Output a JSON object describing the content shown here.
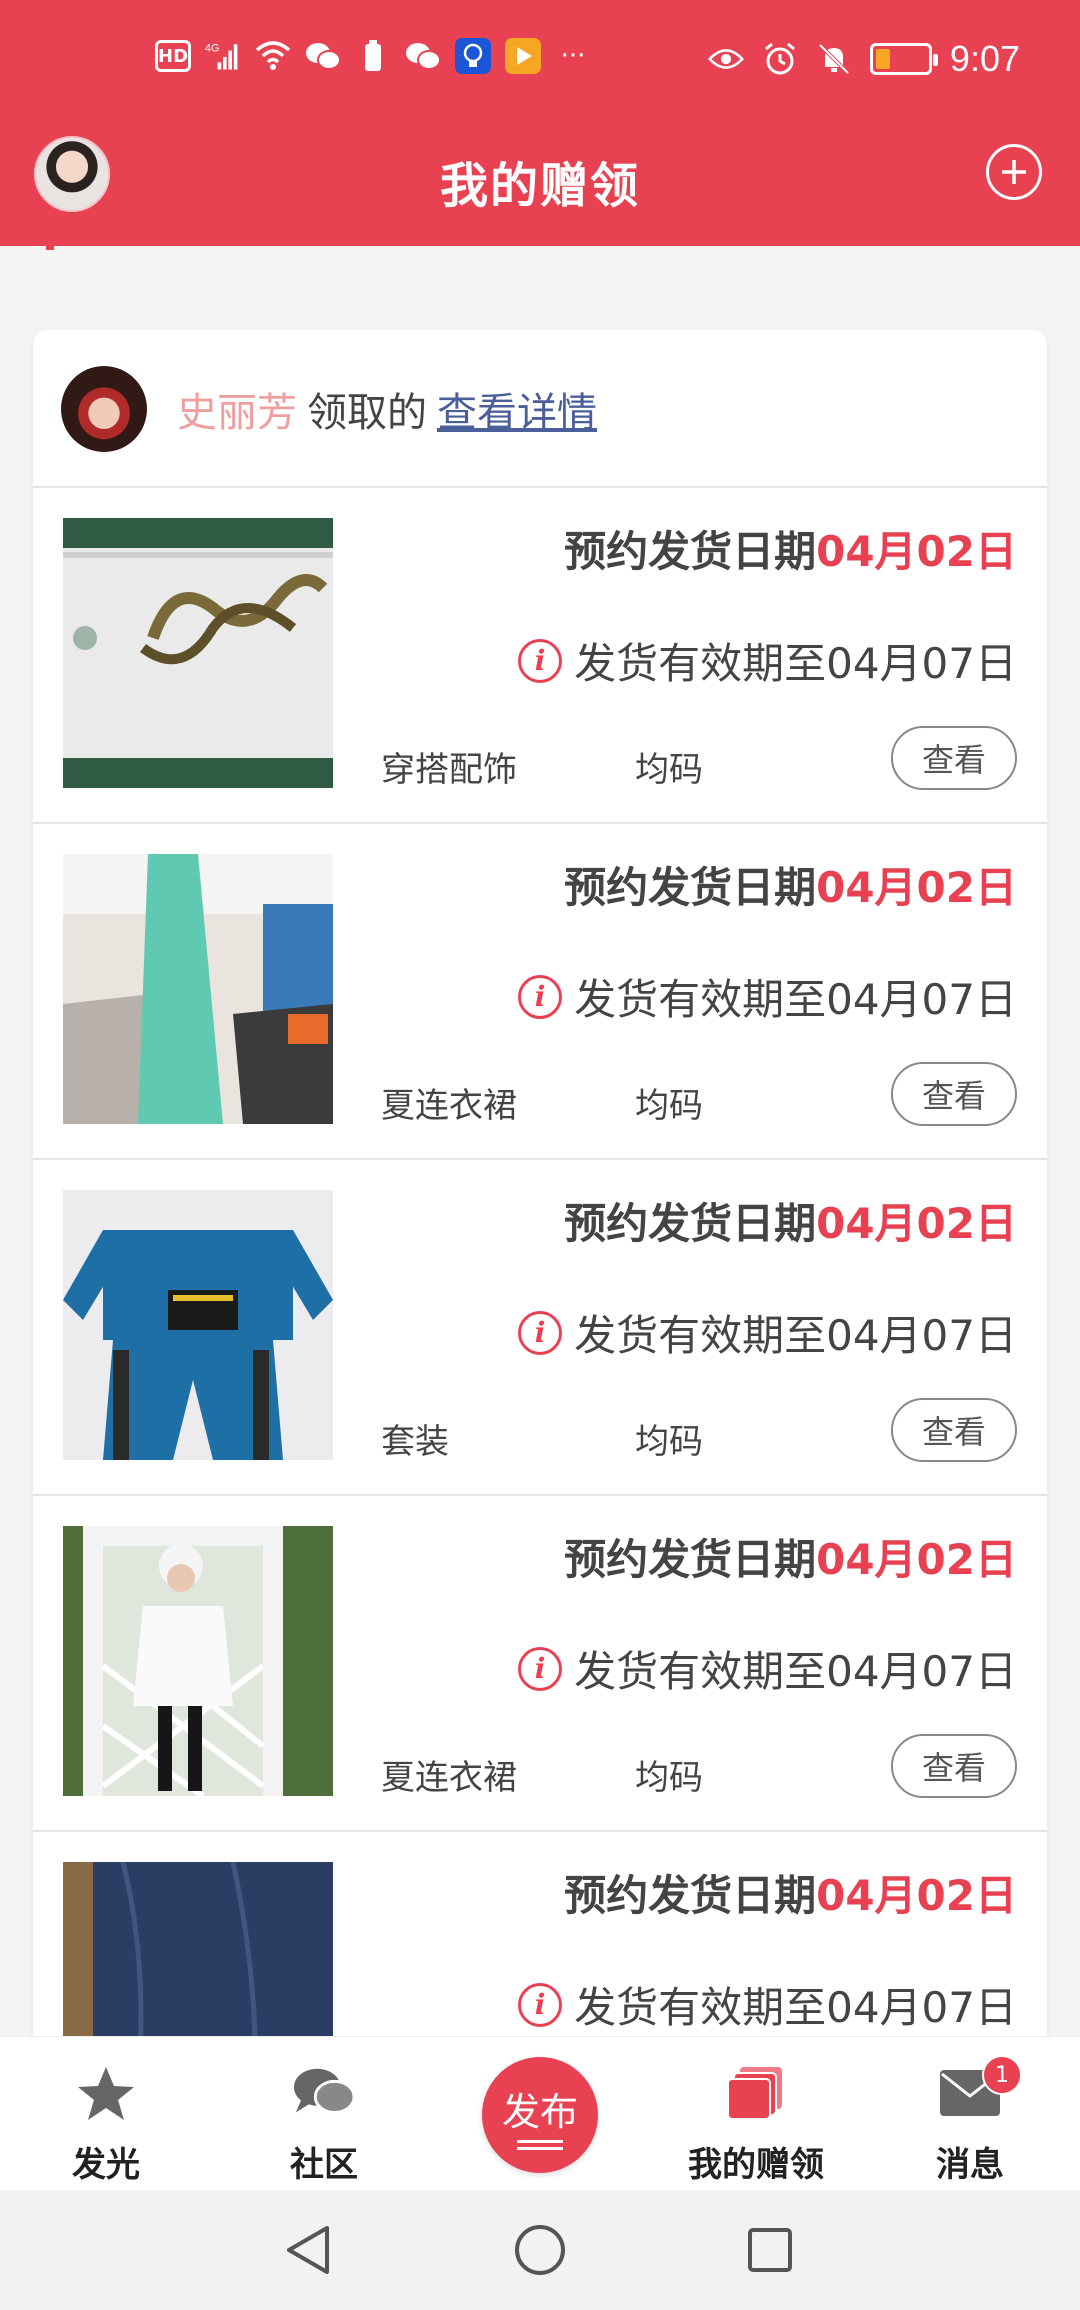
{
  "status_bar": {
    "hd_badge": "HD",
    "network": "4G",
    "time": "9:07",
    "more": "···"
  },
  "app_bar": {
    "title": "我的赠领"
  },
  "donor": {
    "name": "史丽芳",
    "suffix": "领取的",
    "detail_link": "查看详情"
  },
  "items": [
    {
      "date_label": "预约发货日期",
      "date_value": "04月02日",
      "valid_text": "发货有效期至04月07日",
      "category": "穿搭配饰",
      "size": "均码",
      "view_label": "查看"
    },
    {
      "date_label": "预约发货日期",
      "date_value": "04月02日",
      "valid_text": "发货有效期至04月07日",
      "category": "夏连衣裙",
      "size": "均码",
      "view_label": "查看"
    },
    {
      "date_label": "预约发货日期",
      "date_value": "04月02日",
      "valid_text": "发货有效期至04月07日",
      "category": "套装",
      "size": "均码",
      "view_label": "查看"
    },
    {
      "date_label": "预约发货日期",
      "date_value": "04月02日",
      "valid_text": "发货有效期至04月07日",
      "category": "夏连衣裙",
      "size": "均码",
      "view_label": "查看"
    },
    {
      "date_label": "预约发货日期",
      "date_value": "04月02日",
      "valid_text": "发货有效期至04月07日",
      "category": "",
      "size": "",
      "view_label": ""
    }
  ],
  "tabbar": {
    "shine": "发光",
    "community": "社区",
    "publish": "发布",
    "my_gifts": "我的赠领",
    "messages": "消息",
    "message_badge": "1"
  },
  "colors": {
    "brand": "#e84152",
    "link": "#4a5f9a",
    "donor_name": "#eea0a0"
  }
}
